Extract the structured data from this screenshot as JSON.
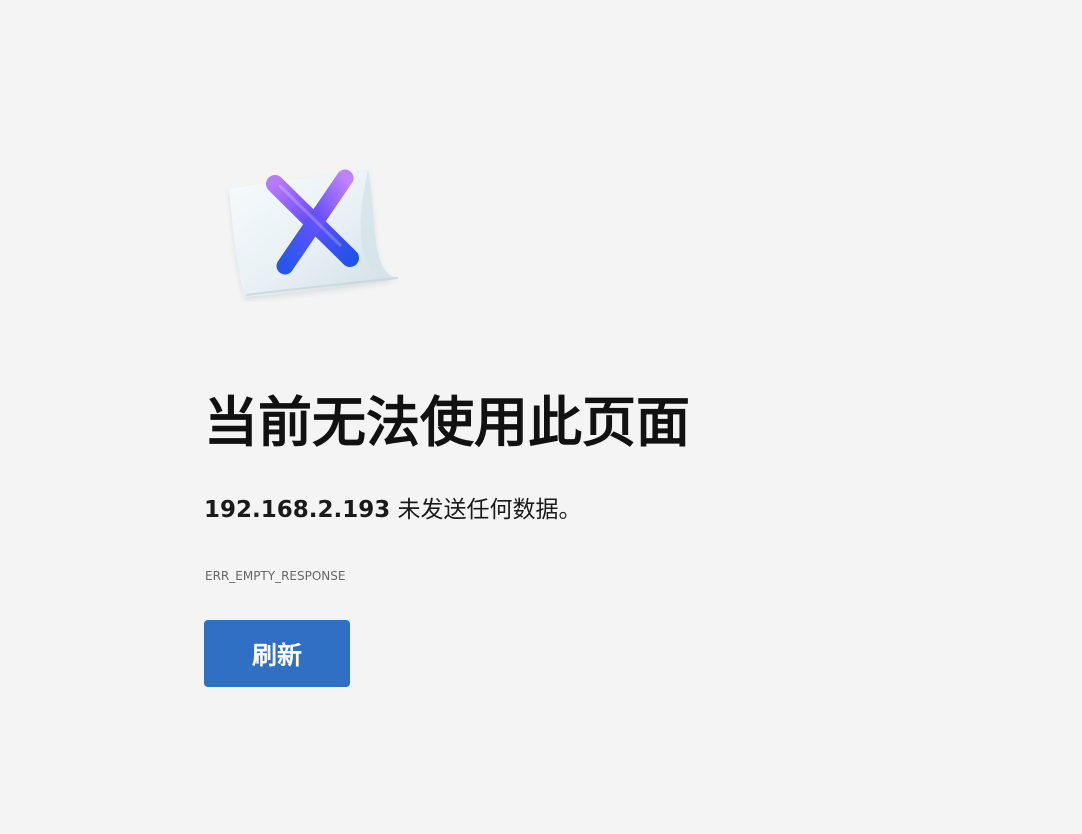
{
  "page": {
    "background_color": "#f4f4f4",
    "icon": "error-x-note-icon"
  },
  "error": {
    "title": "当前无法使用此页面",
    "host": "192.168.2.193",
    "message_suffix": " 未发送任何数据。",
    "code": "ERR_EMPTY_RESPONSE"
  },
  "actions": {
    "reload_label": "刷新",
    "reload_color": "#2f6fc4"
  }
}
